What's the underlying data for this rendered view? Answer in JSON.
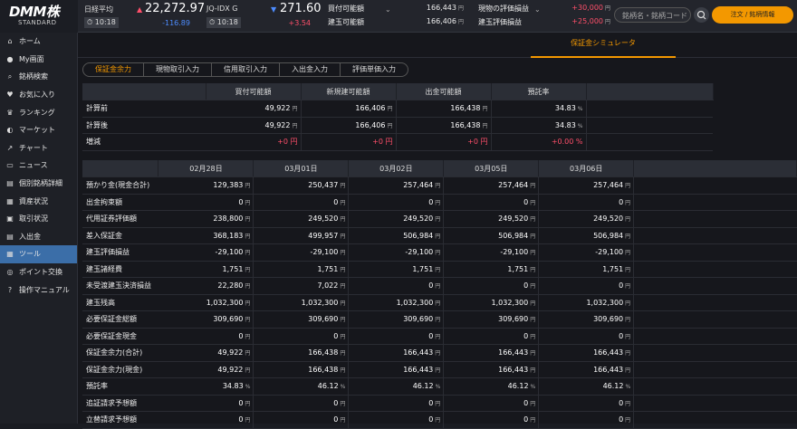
{
  "brand": {
    "name": "DMM株",
    "sub": "STANDARD"
  },
  "indices": [
    {
      "name": "日経平均",
      "arrow": "▲",
      "value": "22,272.97",
      "time": "10:18",
      "change": "-116.89"
    },
    {
      "name": "JQ-IDX G",
      "arrow": "▼",
      "value": "271.60",
      "time": "10:18",
      "change": "+3.54"
    }
  ],
  "summary": {
    "buy_power_label": "買付可能額",
    "buy_power": "166,443",
    "buy_unit": "円",
    "margin_power_label": "建玉可能額",
    "margin_power": "166,406",
    "margin_unit": "円",
    "spot_pl_label": "現物の評価損益",
    "spot_pl": "+30,000",
    "spot_unit": "円",
    "margin_pl_label": "建玉評価損益",
    "margin_pl": "+25,000",
    "margin_pl_unit": "円"
  },
  "search": {
    "placeholder": "銘柄名・銘柄コード"
  },
  "order_button": "注文 / 銘柄情報",
  "sidebar": [
    {
      "icon": "⌂",
      "label": "ホーム"
    },
    {
      "icon": "●",
      "label": "My画面"
    },
    {
      "icon": "⌕",
      "label": "銘柄検索"
    },
    {
      "icon": "♥",
      "label": "お気に入り"
    },
    {
      "icon": "♛",
      "label": "ランキング"
    },
    {
      "icon": "◐",
      "label": "マーケット"
    },
    {
      "icon": "↗",
      "label": "チャート"
    },
    {
      "icon": "▭",
      "label": "ニュース"
    },
    {
      "icon": "▤",
      "label": "個別銘柄詳細"
    },
    {
      "icon": "▦",
      "label": "資産状況"
    },
    {
      "icon": "▣",
      "label": "取引状況"
    },
    {
      "icon": "▤",
      "label": "入出金"
    },
    {
      "icon": "▦",
      "label": "ツール"
    },
    {
      "icon": "◎",
      "label": "ポイント交換"
    },
    {
      "icon": "?",
      "label": "操作マニュアル"
    }
  ],
  "tab_title": "保証金シミュレータ",
  "subtabs": [
    "保証金余力",
    "現物取引入力",
    "信用取引入力",
    "入出金入力",
    "評価単価入力"
  ],
  "table1": {
    "headers": [
      "",
      "買付可能額",
      "新規建可能額",
      "出金可能額",
      "預託率"
    ],
    "rows": [
      {
        "label": "計算前",
        "v": [
          "49,922",
          "166,406",
          "166,438",
          "34.83"
        ],
        "u": [
          "円",
          "円",
          "円",
          "%"
        ]
      },
      {
        "label": "計算後",
        "v": [
          "49,922",
          "166,406",
          "166,438",
          "34.83"
        ],
        "u": [
          "円",
          "円",
          "円",
          "%"
        ]
      },
      {
        "label": "増減",
        "v": [
          "+0 円",
          "+0 円",
          "+0 円",
          "+0.00 %"
        ],
        "u": [
          "",
          "",
          "",
          ""
        ]
      }
    ]
  },
  "table2": {
    "headers": [
      "",
      "02月28日",
      "03月01日",
      "03月02日",
      "03月05日",
      "03月06日"
    ],
    "rows": [
      {
        "label": "預かり金(現金合計)",
        "v": [
          "129,383",
          "250,437",
          "257,464",
          "257,464",
          "257,464"
        ],
        "u": "円"
      },
      {
        "label": "出金拘束額",
        "v": [
          "0",
          "0",
          "0",
          "0",
          "0"
        ],
        "u": "円"
      },
      {
        "label": "代用証券評価額",
        "v": [
          "238,800",
          "249,520",
          "249,520",
          "249,520",
          "249,520"
        ],
        "u": "円"
      },
      {
        "label": "差入保証金",
        "v": [
          "368,183",
          "499,957",
          "506,984",
          "506,984",
          "506,984"
        ],
        "u": "円"
      },
      {
        "label": "建玉評価損益",
        "v": [
          "-29,100",
          "-29,100",
          "-29,100",
          "-29,100",
          "-29,100"
        ],
        "u": "円"
      },
      {
        "label": "建玉諸経費",
        "v": [
          "1,751",
          "1,751",
          "1,751",
          "1,751",
          "1,751"
        ],
        "u": "円"
      },
      {
        "label": "未受渡建玉決済損益",
        "v": [
          "22,280",
          "7,022",
          "0",
          "0",
          "0"
        ],
        "u": "円"
      },
      {
        "label": "建玉残高",
        "v": [
          "1,032,300",
          "1,032,300",
          "1,032,300",
          "1,032,300",
          "1,032,300"
        ],
        "u": "円"
      },
      {
        "label": "必要保証金総額",
        "v": [
          "309,690",
          "309,690",
          "309,690",
          "309,690",
          "309,690"
        ],
        "u": "円"
      },
      {
        "label": "必要保証金現金",
        "v": [
          "0",
          "0",
          "0",
          "0",
          "0"
        ],
        "u": "円"
      },
      {
        "label": "保証金余力(合計)",
        "v": [
          "49,922",
          "166,438",
          "166,443",
          "166,443",
          "166,443"
        ],
        "u": "円"
      },
      {
        "label": "保証金余力(現金)",
        "v": [
          "49,922",
          "166,438",
          "166,443",
          "166,443",
          "166,443"
        ],
        "u": "円"
      },
      {
        "label": "預託率",
        "v": [
          "34.83",
          "46.12",
          "46.12",
          "46.12",
          "46.12"
        ],
        "u": "%"
      },
      {
        "label": "追証請求予想額",
        "v": [
          "0",
          "0",
          "0",
          "0",
          "0"
        ],
        "u": "円"
      },
      {
        "label": "立替請求予想額",
        "v": [
          "0",
          "0",
          "0",
          "0",
          "0"
        ],
        "u": "円"
      }
    ]
  },
  "colors": {
    "accent": "#f39800",
    "positive": "#ff4f6a",
    "negative": "#4d8cff",
    "active": "#3b6ea8"
  }
}
